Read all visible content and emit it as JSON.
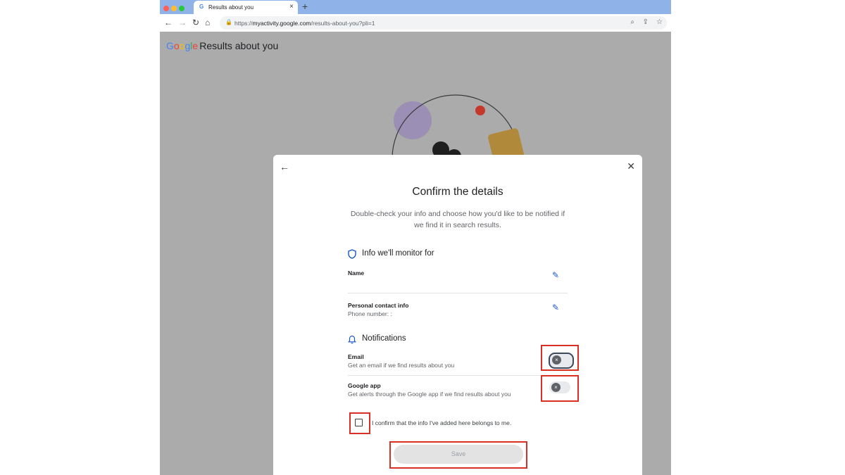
{
  "browser": {
    "tab_favicon": "G",
    "tab_title": "Results about you",
    "tab_close": "×",
    "new_tab": "+",
    "url_prefix": "https://",
    "url_domain": "myactivity.google.com",
    "url_path": "/results-about-you?pli=1",
    "icons": [
      "back-icon",
      "forward-icon",
      "reload-icon",
      "home-icon",
      "lock-icon",
      "zoom-icon",
      "share-icon",
      "bookmark-star-icon"
    ],
    "traffic_lights": [
      "#ff5f57",
      "#febc2e",
      "#28c840"
    ]
  },
  "page": {
    "brand_letters": [
      {
        "char": "G",
        "color": "#4285f4"
      },
      {
        "char": "o",
        "color": "#ea4335"
      },
      {
        "char": "o",
        "color": "#fbbc05"
      },
      {
        "char": "g",
        "color": "#4285f4"
      },
      {
        "char": "l",
        "color": "#34a853"
      },
      {
        "char": "e",
        "color": "#ea4335"
      }
    ],
    "brand_suffix": "Results about you"
  },
  "dialog": {
    "title": "Confirm the details",
    "subtitle": "Double-check your info and choose how you'd like to be notified if we find it in search results.",
    "monitor_heading": "Info we'll monitor for",
    "name_label": "Name",
    "contact_label": "Personal contact info",
    "contact_value": "Phone number: :",
    "notifications_heading": "Notifications",
    "email_label": "Email",
    "email_desc": "Get an email if we find results about you",
    "email_enabled": false,
    "app_label": "Google app",
    "app_desc": "Get alerts through the Google app if we find results about you",
    "app_enabled": false,
    "toggle_off_glyph": "×",
    "confirm_text": "I confirm that the info I've added here belongs to me.",
    "confirm_checked": false,
    "save_label": "Save"
  },
  "colors": {
    "highlight": "#d93025",
    "edit_icon": "#1a56c8",
    "overlay": "#ababab"
  }
}
